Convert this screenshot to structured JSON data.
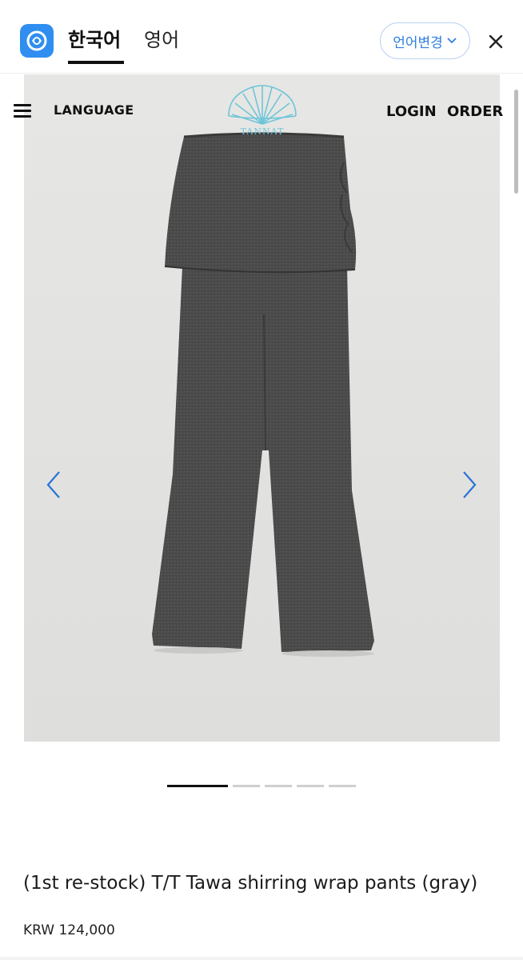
{
  "translator_bar": {
    "tab_source": "한국어",
    "tab_target": "영어",
    "change_language_label": "언어변경"
  },
  "site_header": {
    "language_label": "LANGUAGE",
    "brand_name": "TANNAT",
    "login_label": "LOGIN",
    "order_label": "ORDER"
  },
  "gallery": {
    "slide_count": 5,
    "active_slide": 1
  },
  "product": {
    "title": "(1st re-stock) T/T Tawa shirring wrap pants (gray)",
    "price": "KRW 124,000"
  },
  "colors": {
    "accent_blue": "#2f8ef0",
    "product_gray": "#4a4a4a",
    "backdrop": "#e3e3e1"
  }
}
